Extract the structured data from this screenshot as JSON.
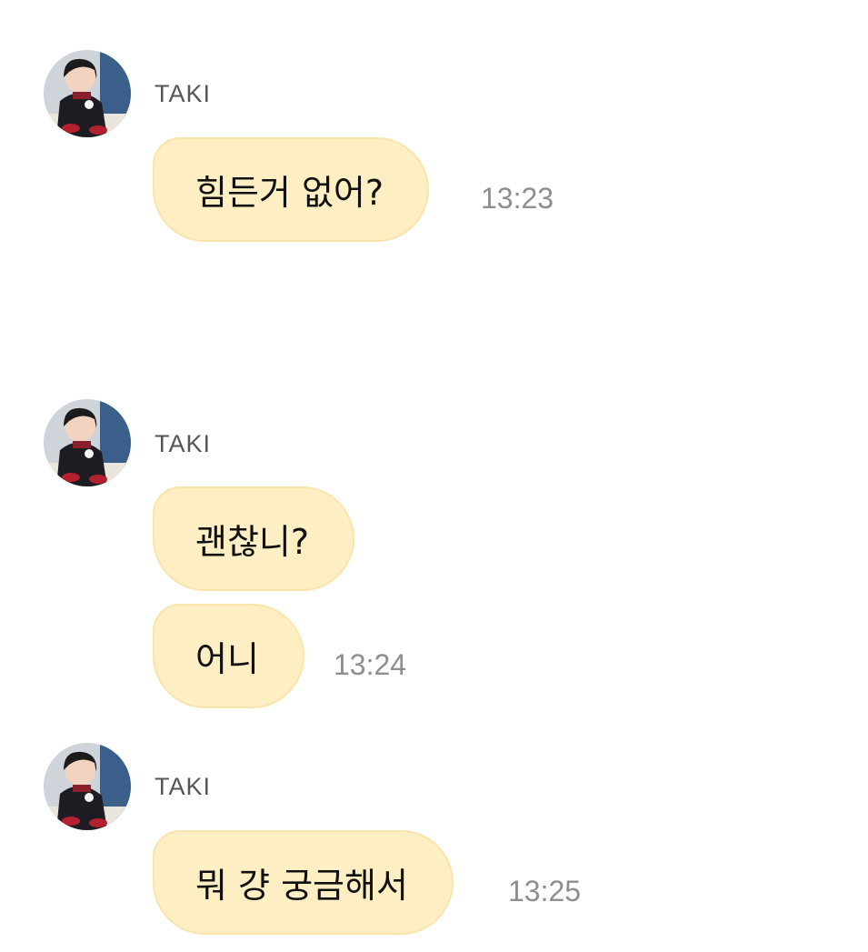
{
  "groups": [
    {
      "sender": "TAKI",
      "messages": [
        {
          "text": "힘든거 없어?",
          "time": "13:23"
        }
      ]
    },
    {
      "sender": "TAKI",
      "messages": [
        {
          "text": "괜찮니?",
          "time": ""
        },
        {
          "text": "어니",
          "time": "13:24"
        }
      ]
    },
    {
      "sender": "TAKI",
      "messages": [
        {
          "text": "뭐 걍 궁금해서",
          "time": "13:25"
        }
      ]
    }
  ],
  "colors": {
    "bubble": "#fdeec4",
    "bubble_border": "#f9e4ac",
    "time": "#8e8e8e",
    "sender": "#555555"
  }
}
